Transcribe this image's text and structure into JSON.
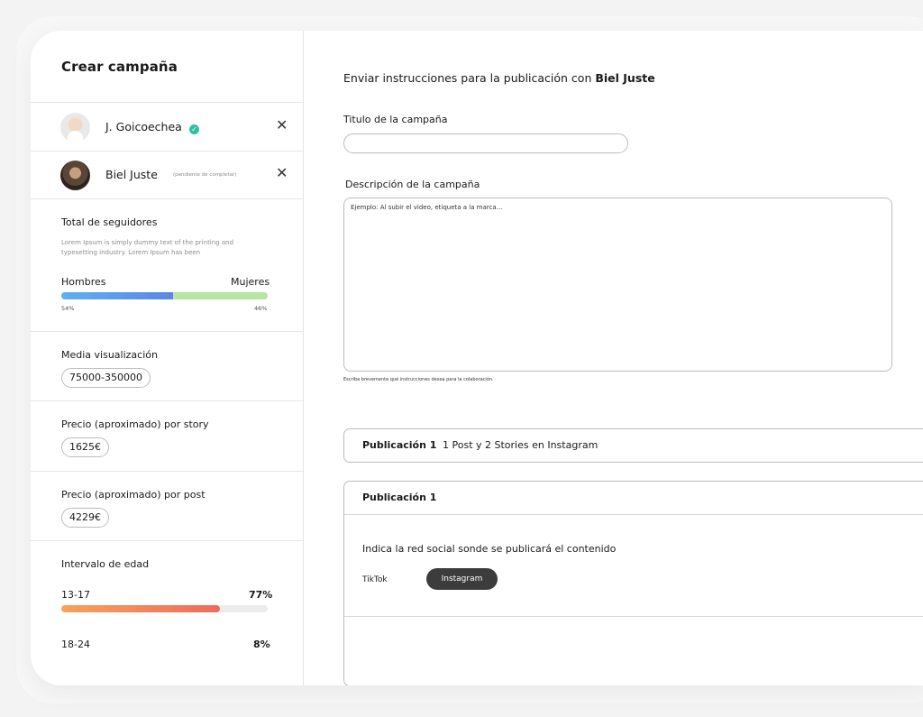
{
  "sidebar": {
    "title": "Crear campaña",
    "influencers": [
      {
        "name": "J. Goicoechea",
        "verified": true,
        "status": ""
      },
      {
        "name": "Biel Juste",
        "verified": false,
        "status": "(pendiente de completar)"
      }
    ],
    "followers": {
      "title": "Total de seguidores",
      "description": "Lorem Ipsum is simply dummy text of the printing and typesetting industry. Lorem Ipsum has been",
      "male_label": "Hombres",
      "female_label": "Mujeres",
      "male_pct": "54%",
      "female_pct": "46%",
      "male_value": 54,
      "female_value": 46
    },
    "views": {
      "title": "Media visualización",
      "value": "75000-350000"
    },
    "story_price": {
      "title": "Precio (aproximado) por story",
      "value": "1625€"
    },
    "post_price": {
      "title": "Precio (aproximado) por post",
      "value": "4229€"
    },
    "age": {
      "title": "Intervalo de edad",
      "ranges": [
        {
          "label": "13-17",
          "pct": "77%",
          "value": 77
        },
        {
          "label": "18-24",
          "pct": "8%",
          "value": 8
        }
      ]
    }
  },
  "main": {
    "heading_prefix": "Enviar instrucciones para la publicación con",
    "heading_name": "Biel Juste",
    "campaign_title_label": "Titulo de la campaña",
    "campaign_title_value": "",
    "description_label": "Descripción de la campaña",
    "description_placeholder": "Ejemplo: Al subir el video, etiqueta a la marca...",
    "description_helper": "Escriba brevemente qué instrucciones desea para la colaboración.",
    "publications": [
      {
        "title": "Publicación 1",
        "summary": "1 Post y 2 Stories en Instagram"
      },
      {
        "title": "Publicación 1",
        "summary": ""
      }
    ],
    "network_question": "Indica la red social sonde se publicará el contenido",
    "network_options": [
      "TikTok",
      "Instagram"
    ],
    "network_selected": "Instagram"
  },
  "colors": {
    "verified": "#2fbfa5",
    "male_bar": "#5b87e6",
    "female_bar": "#b7e6a2",
    "age_bar": "#ef6b5d",
    "selected_button": "#3c3c3c"
  }
}
